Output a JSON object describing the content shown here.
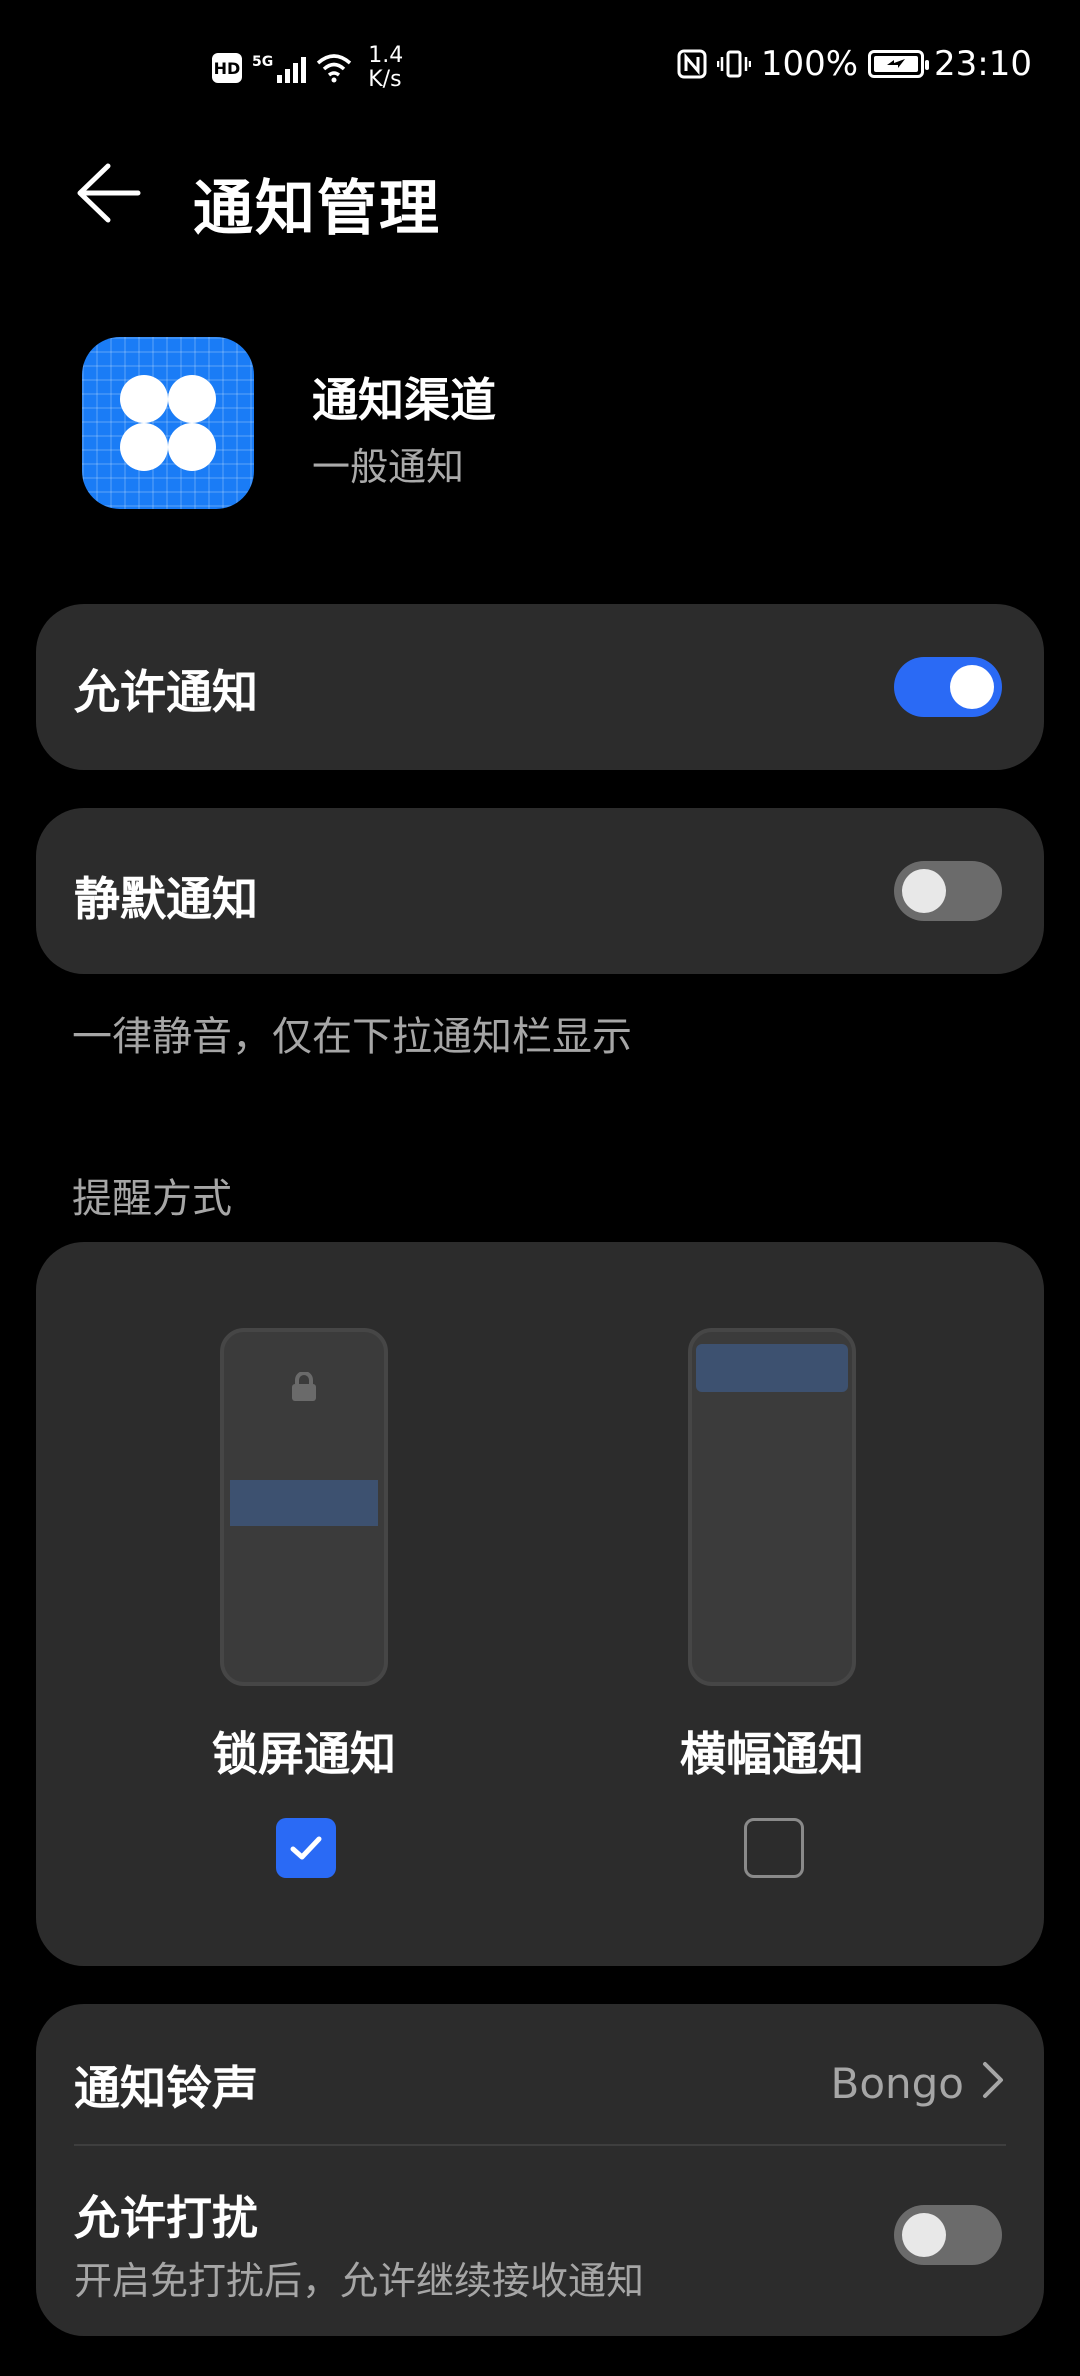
{
  "status_bar": {
    "hd": "HD",
    "network": "5G",
    "speed_value": "1.4",
    "speed_unit": "K/s",
    "battery": "100%",
    "time": "23:10"
  },
  "header": {
    "title": "通知管理"
  },
  "app": {
    "name": "通知渠道",
    "channel": "一般通知",
    "accent": "#1a7cf6"
  },
  "settings": {
    "allow_notifications": {
      "label": "允许通知",
      "enabled": true
    },
    "silent_notifications": {
      "label": "静默通知",
      "enabled": false
    },
    "silent_note": "一律静音，仅在下拉通知栏显示"
  },
  "reminder": {
    "section_title": "提醒方式",
    "options": [
      {
        "label": "锁屏通知",
        "checked": true
      },
      {
        "label": "横幅通知",
        "checked": false
      }
    ]
  },
  "sound": {
    "label": "通知铃声",
    "value": "Bongo"
  },
  "dnd": {
    "label": "允许打扰",
    "description": "开启免打扰后，允许继续接收通知",
    "enabled": false
  },
  "colors": {
    "toggle_on": "#2a6af5",
    "card_bg": "#2c2c2c"
  }
}
